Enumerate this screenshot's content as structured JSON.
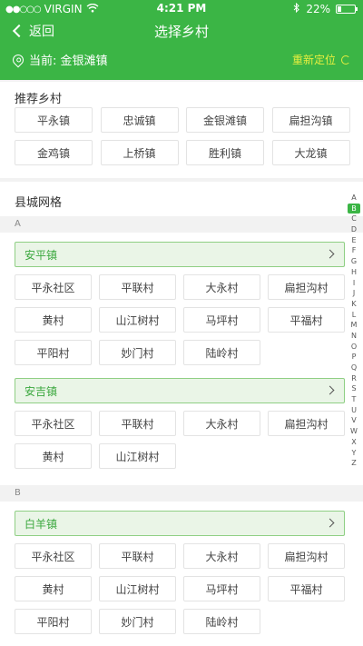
{
  "status": {
    "carrier": "VIRGIN",
    "time": "4:21 PM",
    "battery": "22%",
    "battery_level": 0.22
  },
  "nav": {
    "back": "返回",
    "title": "选择乡村"
  },
  "location": {
    "current": "当前: 金银滩镇",
    "relocate": "重新定位"
  },
  "recommended": {
    "title": "推荐乡村",
    "items": [
      "平永镇",
      "忠诚镇",
      "金银滩镇",
      "扁担沟镇",
      "金鸡镇",
      "上桥镇",
      "胜利镇",
      "大龙镇"
    ]
  },
  "county": {
    "title": "县城网格"
  },
  "groups": [
    {
      "letter": "A",
      "towns": [
        {
          "name": "安平镇",
          "villages": [
            "平永社区",
            "平联村",
            "大永村",
            "扁担沟村",
            "黄村",
            "山江树村",
            "马坪村",
            "平福村",
            "平阳村",
            "妙门村",
            "陆岭村"
          ]
        },
        {
          "name": "安吉镇",
          "villages": [
            "平永社区",
            "平联村",
            "大永村",
            "扁担沟村",
            "黄村",
            "山江树村"
          ]
        }
      ]
    },
    {
      "letter": "B",
      "towns": [
        {
          "name": "白羊镇",
          "villages": [
            "平永社区",
            "平联村",
            "大永村",
            "扁担沟村",
            "黄村",
            "山江树村",
            "马坪村",
            "平福村",
            "平阳村",
            "妙门村",
            "陆岭村"
          ]
        }
      ]
    }
  ],
  "index": {
    "letters": [
      "A",
      "B",
      "C",
      "D",
      "E",
      "F",
      "G",
      "H",
      "I",
      "J",
      "K",
      "L",
      "M",
      "N",
      "O",
      "P",
      "Q",
      "R",
      "S",
      "T",
      "U",
      "V",
      "W",
      "X",
      "Y",
      "Z"
    ],
    "active": "B"
  },
  "colors": {
    "primary": "#3bb545",
    "accent": "#e8ef3f",
    "town_bg": "#eaf5e7"
  }
}
